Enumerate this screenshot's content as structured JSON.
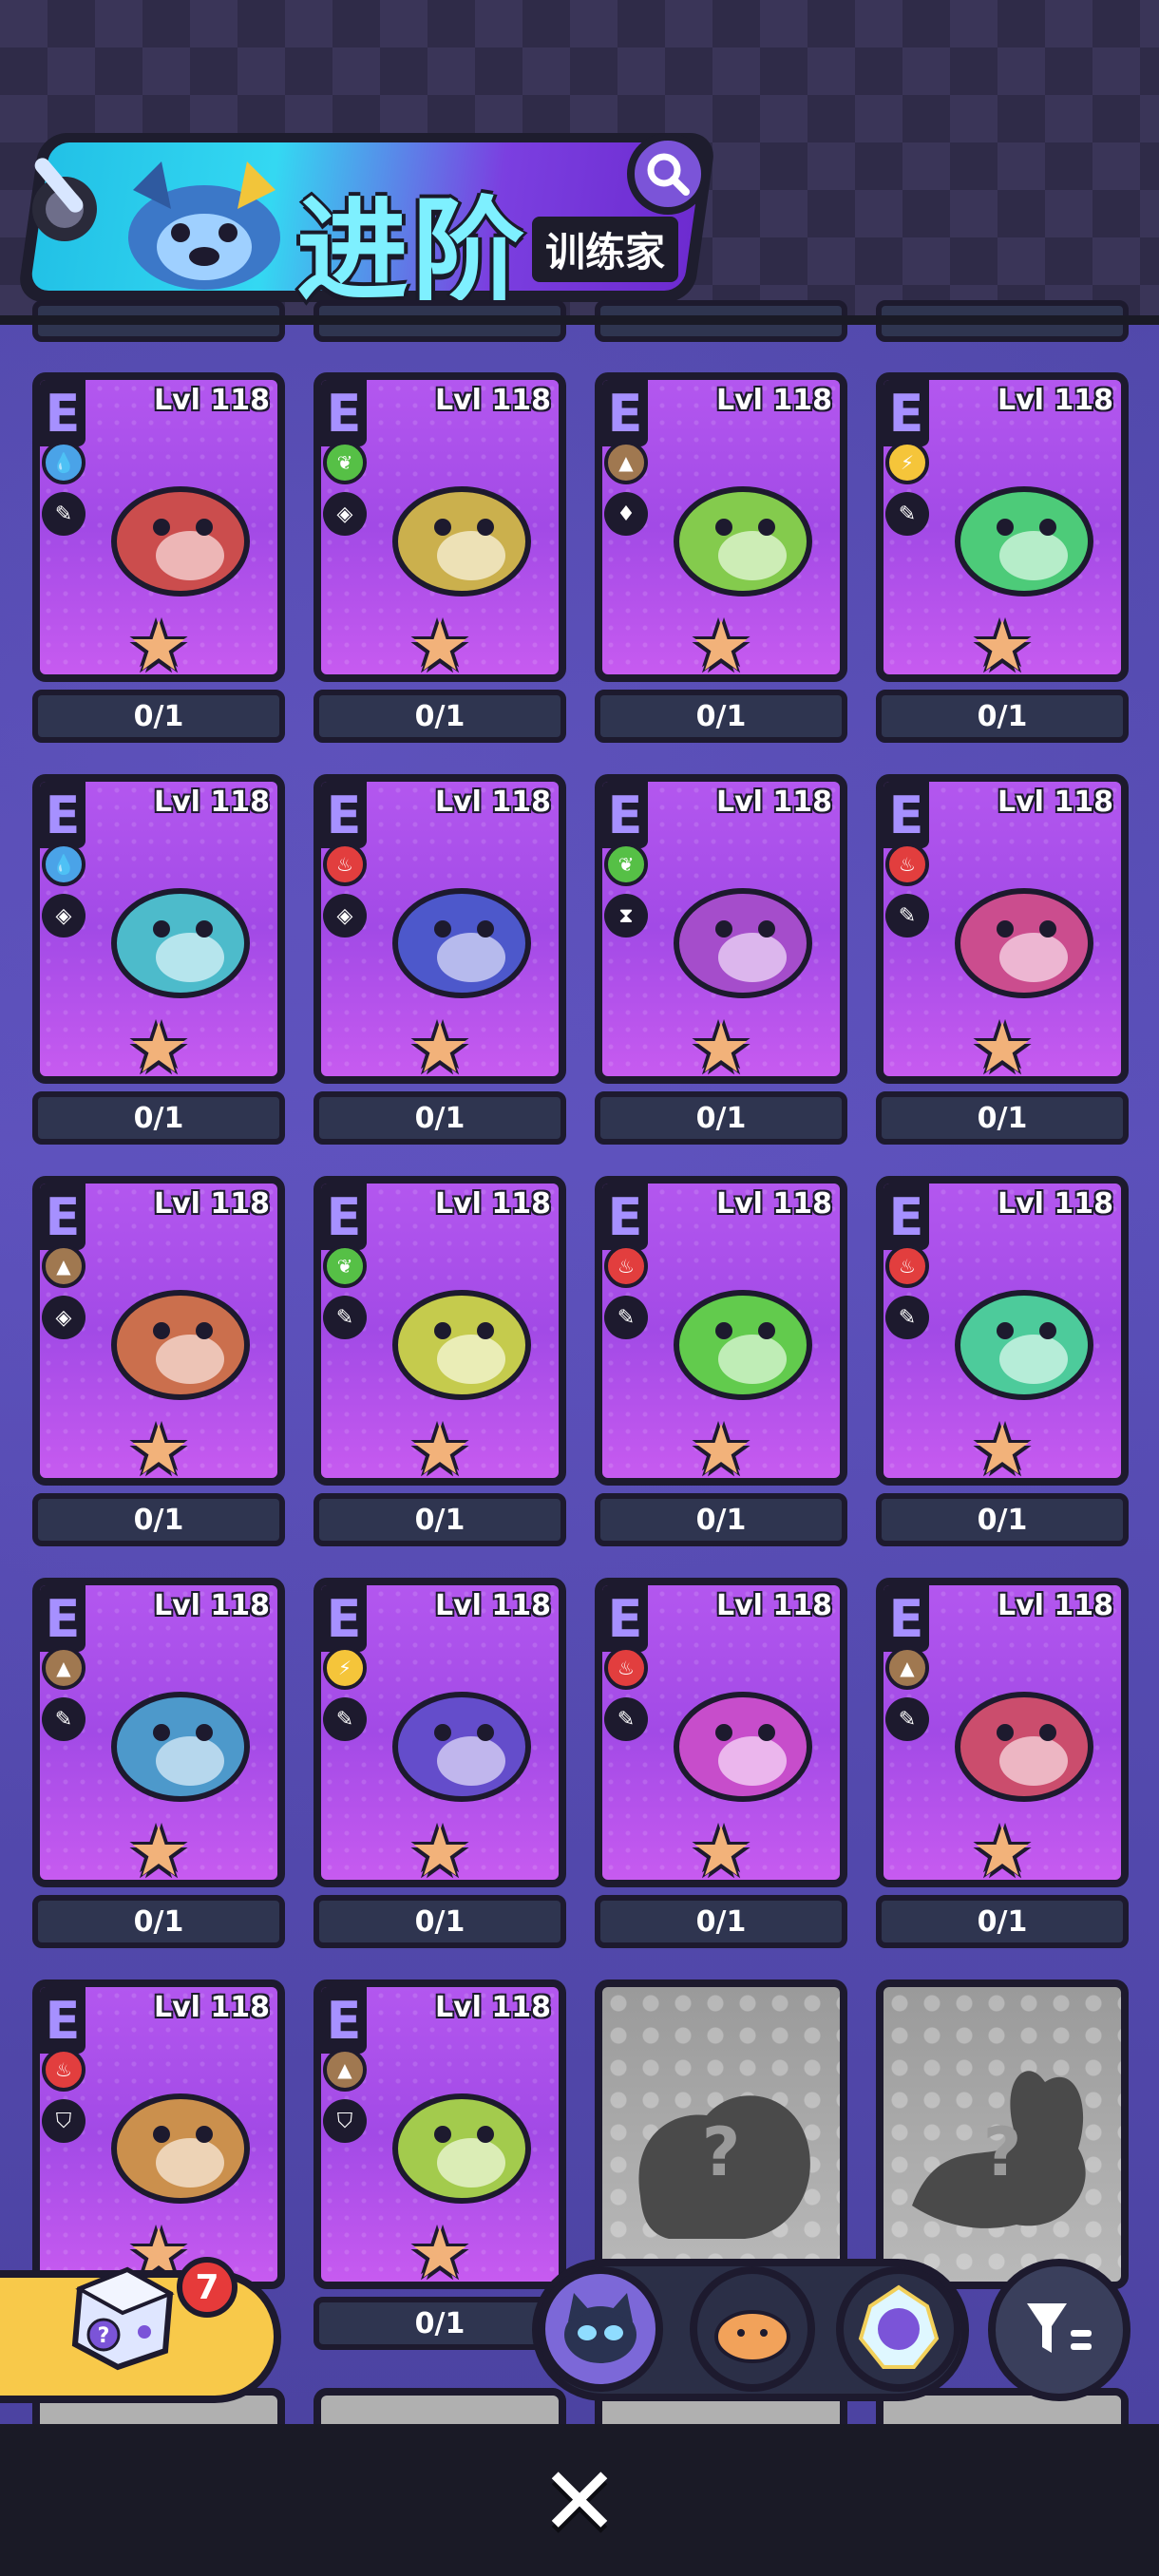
{
  "header": {
    "title": "进阶",
    "subtitle": "训练家"
  },
  "colors": {
    "card_bg": "#b357ef",
    "water": "#4aa3e8",
    "grass": "#56c046",
    "ground": "#a07850",
    "electric": "#f5c53a",
    "fire": "#e23e3e",
    "locked": "#a8a8a8"
  },
  "cards": [
    {
      "grade": "E",
      "level": "Lvl 118",
      "element": "water",
      "trait": "pin",
      "count": "0/1",
      "creature": "blue-bear"
    },
    {
      "grade": "E",
      "level": "Lvl 118",
      "element": "grass",
      "trait": "eye",
      "count": "0/1",
      "creature": "green-bird"
    },
    {
      "grade": "E",
      "level": "Lvl 118",
      "element": "ground",
      "trait": "bulb",
      "count": "0/1",
      "creature": "monkey"
    },
    {
      "grade": "E",
      "level": "Lvl 118",
      "element": "electric",
      "trait": "pin",
      "count": "0/1",
      "creature": "rhino"
    },
    {
      "grade": "E",
      "level": "Lvl 118",
      "element": "water",
      "trait": "eye",
      "count": "0/1",
      "creature": "chameleon"
    },
    {
      "grade": "E",
      "level": "Lvl 118",
      "element": "fire",
      "trait": "eye",
      "count": "0/1",
      "creature": "tiger"
    },
    {
      "grade": "E",
      "level": "Lvl 118",
      "element": "grass",
      "trait": "flask",
      "count": "0/1",
      "creature": "mushroom"
    },
    {
      "grade": "E",
      "level": "Lvl 118",
      "element": "fire",
      "trait": "pin",
      "count": "0/1",
      "creature": "cat"
    },
    {
      "grade": "E",
      "level": "Lvl 118",
      "element": "ground",
      "trait": "eye",
      "count": "0/1",
      "creature": "mole"
    },
    {
      "grade": "E",
      "level": "Lvl 118",
      "element": "grass",
      "trait": "pin",
      "count": "0/1",
      "creature": "seed"
    },
    {
      "grade": "E",
      "level": "Lvl 118",
      "element": "fire",
      "trait": "pin",
      "count": "0/1",
      "creature": "fox"
    },
    {
      "grade": "E",
      "level": "Lvl 118",
      "element": "fire",
      "trait": "pin",
      "count": "0/1",
      "creature": "bird"
    },
    {
      "grade": "E",
      "level": "Lvl 118",
      "element": "ground",
      "trait": "pin",
      "count": "0/1",
      "creature": "snail"
    },
    {
      "grade": "E",
      "level": "Lvl 118",
      "element": "electric",
      "trait": "pin",
      "count": "0/1",
      "creature": "cloud-bird"
    },
    {
      "grade": "E",
      "level": "Lvl 118",
      "element": "fire",
      "trait": "pin",
      "count": "0/1",
      "creature": "lizard"
    },
    {
      "grade": "E",
      "level": "Lvl 118",
      "element": "ground",
      "trait": "pin",
      "count": "0/1",
      "creature": "snake"
    },
    {
      "grade": "E",
      "level": "Lvl 118",
      "element": "fire",
      "trait": "shield",
      "count": "",
      "creature": "penguin"
    },
    {
      "grade": "E",
      "level": "Lvl 118",
      "element": "ground",
      "trait": "shield",
      "count": "0/1",
      "creature": "mouse"
    },
    {
      "grade": "",
      "level": "",
      "element": "",
      "trait": "",
      "count": "",
      "creature": "",
      "locked": true,
      "mark": "?"
    },
    {
      "grade": "",
      "level": "",
      "element": "",
      "trait": "",
      "count": "",
      "creature": "",
      "locked": true,
      "mark": "?"
    }
  ],
  "dice": {
    "badge": "7",
    "mark": "?"
  },
  "bottom": {
    "close_label": "✕"
  }
}
